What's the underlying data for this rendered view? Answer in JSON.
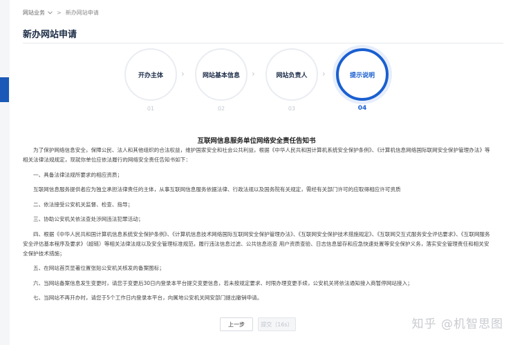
{
  "breadcrumb": {
    "parent": "网站业务",
    "parent_icon": "chevron-down-icon",
    "separator": ">",
    "current": "新办网站申请"
  },
  "page_title": "新办网站申请",
  "steps": [
    {
      "label": "开办主体",
      "number": "01",
      "active": false
    },
    {
      "label": "网站基本信息",
      "number": "02",
      "active": false
    },
    {
      "label": "网站负责人",
      "number": "03",
      "active": false
    },
    {
      "label": "提示说明",
      "number": "04",
      "active": true
    }
  ],
  "notice": {
    "title": "互联网信息服务单位网络安全责任告知书",
    "paragraphs": [
      "为了保护网络信息安全，保障公民、法人和其他组织的合法权益，维护国家安全和社会公共利益，根据《中华人民共和国计算机系统安全保护条例》、《计算机信息网络国际联网安全保护管理办法》等相关法律法规规定，现就你单位应依法履行的网络安全责任告知书如下：",
      "一、具备法律法规所要求的相应资质；",
      "互联网信息服务提供者应为独立承担法律责任的主体，从事互联网信息服务依据法律、行政法规以及国务院有关规定，需经有关部门许可的应取得相应许可资质",
      "二、依法接受公安机关监督、检查、指导；",
      "三、协助公安机关依法查处涉网违法犯罪活动；",
      "四、根据《中华人民共和国计算机信息系统安全保护条例》、《计算机信息技术网络国际互联网安全保护管理办法》、《互联网安全保护技术措施规定》、《互联网交互式服务安全评估要求》、《互联网服务安全评估基本程序及要求》（超链）等相关法律法规以及安全管理标准规范，履行违法信息过滤、公共信息巡查 用户资质查验、日志信息留存和应急快速处置等安全保护义务，落实安全管理责任和相关安全保护技术措施；",
      "五、在网站首页显著位置张贴公安机关核发的备案图标；",
      "六、当网站备案信息发生变更时，请您于变更后30日内登录本平台提交变更信息，若未按规定要求、时限办理变更手续，公安机关将依法通知接入商暂停网站接入；",
      "七、当网站不再开办时，请您于5个工作日内登录本平台，向属地公安机关网安部门提出撤销申请。"
    ]
  },
  "actions": {
    "prev_label": "上一步",
    "submit_label": "提交（16s）"
  },
  "watermark": "知乎 @机智思图",
  "colors": {
    "accent": "#1a5fd0",
    "sidebar_marker": "#1a59b7",
    "inactive_step_border": "#e9ecf1"
  }
}
